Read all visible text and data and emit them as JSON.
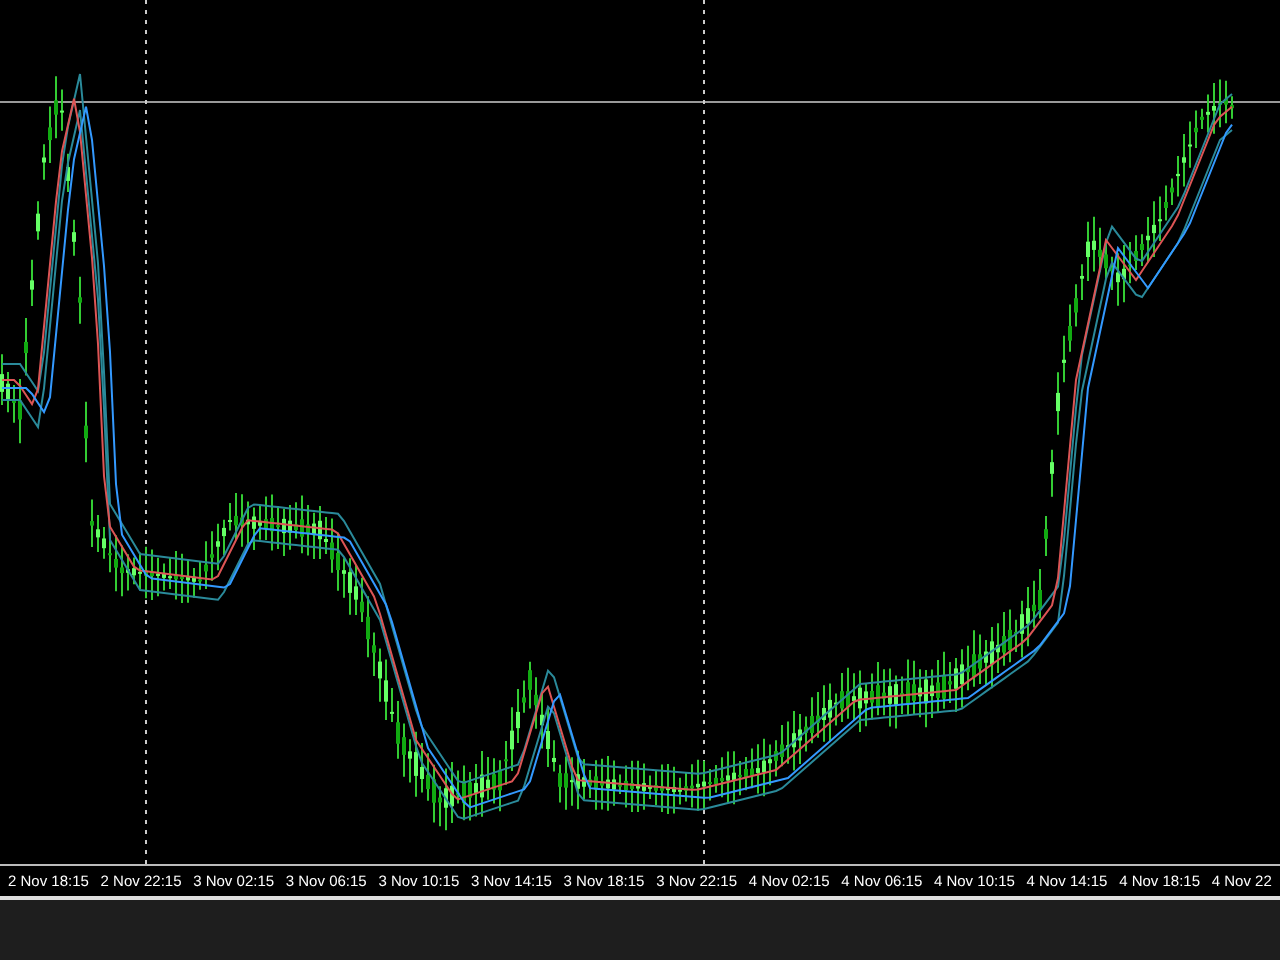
{
  "chart": {
    "kind": "candlestick",
    "time_labels": [
      "2 Nov 18:15",
      "2 Nov 22:15",
      "3 Nov 02:15",
      "3 Nov 06:15",
      "3 Nov 10:15",
      "3 Nov 14:15",
      "3 Nov 18:15",
      "3 Nov 22:15",
      "4 Nov 02:15",
      "4 Nov 06:15",
      "4 Nov 10:15",
      "4 Nov 14:15",
      "4 Nov 18:15",
      "4 Nov 22"
    ]
  }
}
